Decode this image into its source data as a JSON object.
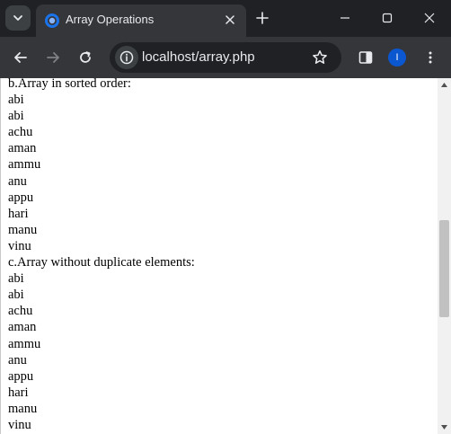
{
  "browser": {
    "tab_title": "Array Operations",
    "url": "localhost/array.php",
    "profile_initial": "I",
    "accent_color": "#0b57d0",
    "icons": {
      "tab_search": "chevron-down-icon",
      "favicon": "chrome-icon",
      "tab_close": "close-icon",
      "new_tab": "plus-icon",
      "minimize": "minimize-icon",
      "maximize": "maximize-icon",
      "close_window": "close-icon",
      "back": "arrow-left-icon",
      "forward": "arrow-right-icon",
      "reload": "reload-icon",
      "site_info": "info-icon",
      "bookmark": "star-icon",
      "side_panel": "side-panel-icon",
      "menu": "kebab-menu-icon"
    }
  },
  "page": {
    "sorted_heading": "b.Array in sorted order:",
    "sorted_items": [
      "abi",
      "abi",
      "achu",
      "aman",
      "ammu",
      "anu",
      "appu",
      "hari",
      "manu",
      "vinu"
    ],
    "unique_heading": "c.Array without duplicate elements:",
    "unique_items": [
      "abi",
      "abi",
      "achu",
      "aman",
      "ammu",
      "anu",
      "appu",
      "hari",
      "manu",
      "vinu"
    ]
  }
}
